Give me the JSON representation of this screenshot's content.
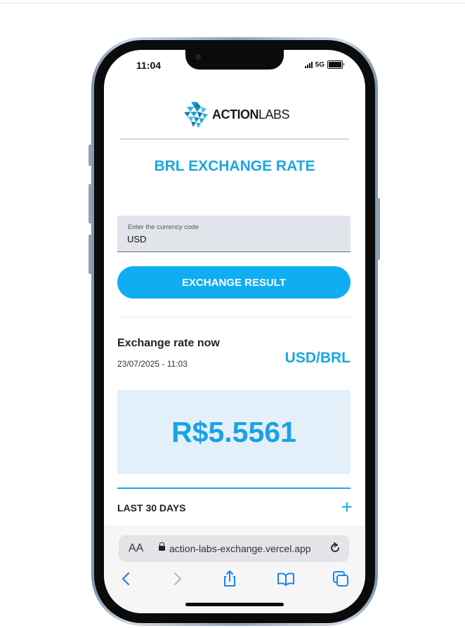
{
  "status_bar": {
    "time": "11:04",
    "network": "5G"
  },
  "logo": {
    "text_bold": "ACTION",
    "text_light": "LABS"
  },
  "title": "BRL EXCHANGE RATE",
  "currency_field": {
    "label": "Enter the currency code",
    "value": "USD"
  },
  "exchange_button": "EXCHANGE RESULT",
  "rate": {
    "label": "Exchange rate now",
    "date": "23/07/2025 - 11:03",
    "pair": "USD/BRL",
    "value": "R$5.5561"
  },
  "history": {
    "label": "LAST 30 DAYS",
    "expand_icon": "+"
  },
  "browser": {
    "aa": "AA",
    "url": "action-labs-exchange.vercel.app"
  },
  "colors": {
    "accent": "#1ba6e3",
    "button": "#10adf3",
    "rate_box": "#e3f0fa"
  }
}
